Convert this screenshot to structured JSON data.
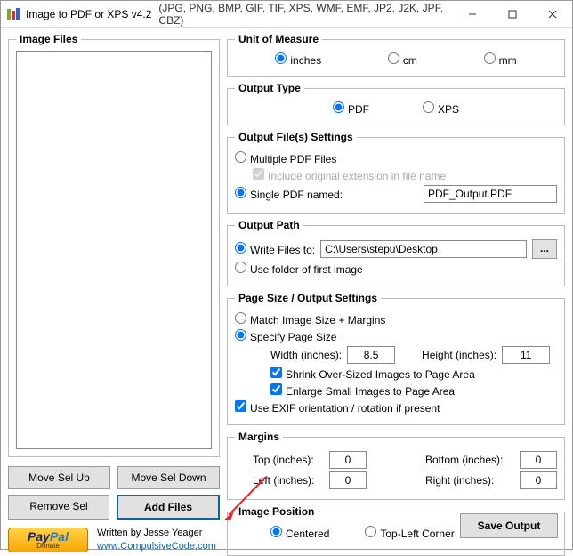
{
  "window": {
    "title": "Image to PDF or XPS  v4.2",
    "formats": "(JPG, PNG, BMP, GIF, TIF, XPS, WMF, EMF, JP2, J2K, JPF, CBZ)"
  },
  "left": {
    "fieldset": "Image Files",
    "moveUp": "Move Sel Up",
    "moveDown": "Move Sel Down",
    "removeSel": "Remove Sel",
    "addFiles": "Add Files"
  },
  "credits": {
    "written": "Written by Jesse Yeager",
    "site": "www.CompulsiveCode.com"
  },
  "unit": {
    "legend": "Unit of Measure",
    "inches": "inches",
    "cm": "cm",
    "mm": "mm"
  },
  "outputType": {
    "legend": "Output Type",
    "pdf": "PDF",
    "xps": "XPS"
  },
  "outputFile": {
    "legend": "Output File(s) Settings",
    "multiple": "Multiple PDF Files",
    "includeExt": "Include original extension in file name",
    "single": "Single PDF named:",
    "singleValue": "PDF_Output.PDF"
  },
  "outputPath": {
    "legend": "Output Path",
    "writeTo": "Write Files to:",
    "pathValue": "C:\\Users\\stepu\\Desktop",
    "useFolder": "Use folder of first image"
  },
  "pageSize": {
    "legend": "Page Size / Output Settings",
    "match": "Match Image Size + Margins",
    "specify": "Specify Page Size",
    "widthLabel": "Width (inches):",
    "widthValue": "8.5",
    "heightLabel": "Height (inches):",
    "heightValue": "11",
    "shrink": "Shrink Over-Sized Images to Page Area",
    "enlarge": "Enlarge Small Images to Page Area",
    "exif": "Use EXIF orientation / rotation if present"
  },
  "margins": {
    "legend": "Margins",
    "topLabel": "Top (inches):",
    "topValue": "0",
    "bottomLabel": "Bottom (inches):",
    "bottomValue": "0",
    "leftLabel": "Left (inches):",
    "leftValue": "0",
    "rightLabel": "Right (inches):",
    "rightValue": "0"
  },
  "imagePos": {
    "legend": "Image Position",
    "centered": "Centered",
    "topLeft": "Top-Left Corner"
  },
  "save": "Save Output",
  "browse": "..."
}
